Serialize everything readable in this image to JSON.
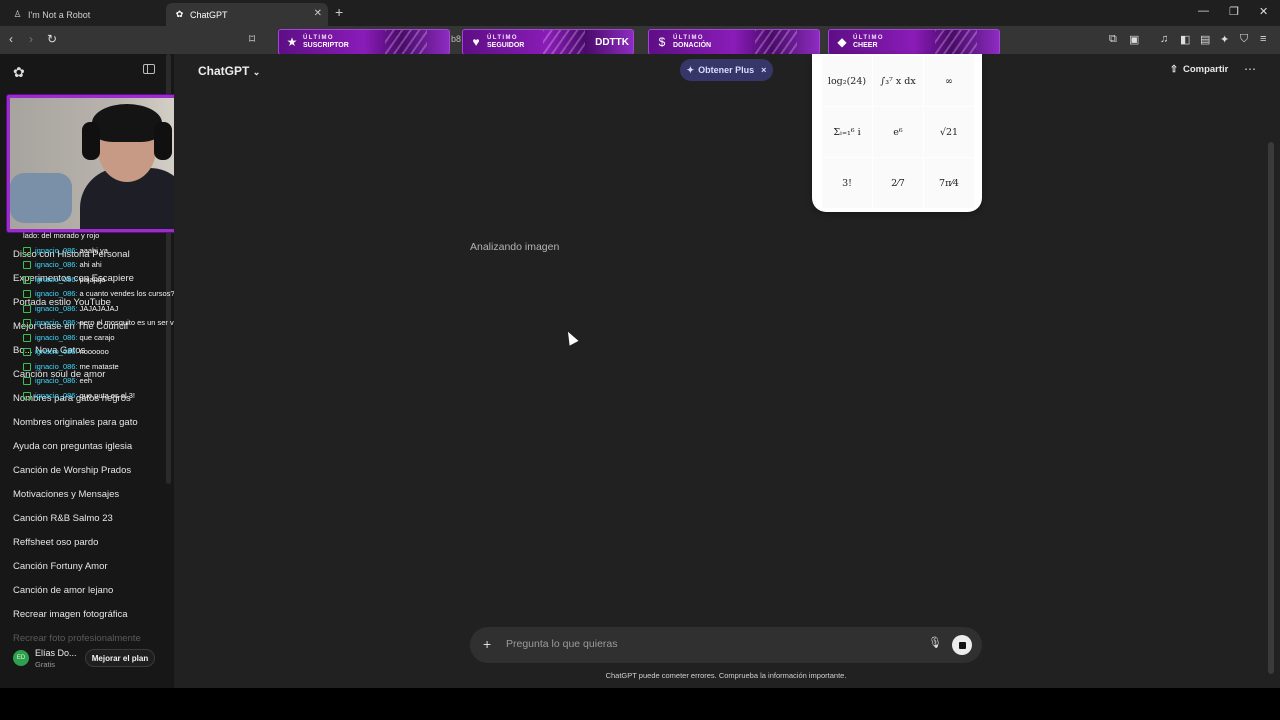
{
  "browser": {
    "tabs": [
      {
        "label": "I'm Not a Robot",
        "icon": "robot-favicon-icon",
        "active": false
      },
      {
        "label": "ChatGPT",
        "icon": "chatgpt-favicon-icon",
        "active": true
      }
    ],
    "url_fragment": "b8"
  },
  "alerts": [
    {
      "line1": "ÚLTIMO",
      "line2": "SUSCRIPTOR",
      "value": "",
      "icon": "star-icon"
    },
    {
      "line1": "ÚLTIMO",
      "line2": "SEGUIDOR",
      "value": "DDTTK",
      "icon": "heart-icon"
    },
    {
      "line1": "ÚLTIMO",
      "line2": "DONACIÓN",
      "value": "",
      "icon": "dollar-icon"
    },
    {
      "line1": "ÚLTIMO",
      "line2": "CHEER",
      "value": "",
      "icon": "diamond-icon"
    }
  ],
  "sidebar": {
    "chats": [
      "Disco con Historia Personal",
      "Experimentos con Escapiere",
      "Portada estilo YouTube",
      "Mejor clase en The Council",
      "Bo... Nova Gatos",
      "Canción soul de amor",
      "Nombres para gatos negros",
      "Nombres originales para gato",
      "Ayuda con preguntas iglesia",
      "Canción de Worship Prados",
      "Motivaciones y Mensajes",
      "Canción R&B Salmo 23",
      "Reffsheet oso pardo",
      "Canción Fortuny Amor",
      "Canción de amor lejano",
      "Recrear imagen fotográfica",
      "Recrear foto profesionalmente"
    ],
    "user": {
      "initials": "ED",
      "name": "Elías Do...",
      "plan": "Gratis",
      "upgrade_label": "Mejorar el plan"
    }
  },
  "stream_chat": [
    {
      "user": "",
      "msg": "lado: del morado y rojo"
    },
    {
      "user": "ignacio_086:",
      "msg": "aaahi ya"
    },
    {
      "user": "ignacio_086:",
      "msg": "ahi ahi"
    },
    {
      "user": "ignacio_086:",
      "msg": "pajajaja"
    },
    {
      "user": "ignacio_086:",
      "msg": "a cuanto vendes los cursos?"
    },
    {
      "user": "ignacio_086:",
      "msg": "JAJAJAJAJ"
    },
    {
      "user": "ignacio_086:",
      "msg": "pero el mosquito es un ser vivo"
    },
    {
      "user": "ignacio_086:",
      "msg": "que carajo"
    },
    {
      "user": "ignacio_086:",
      "msg": "noooooo"
    },
    {
      "user": "ignacio_086:",
      "msg": "me mataste"
    },
    {
      "user": "ignacio_086:",
      "msg": "eeh"
    },
    {
      "user": "ignacio_086:",
      "msg": "que puta es el 3!"
    }
  ],
  "header": {
    "model_label": "ChatGPT",
    "plus_label": "Obtener Plus",
    "share_label": "Compartir"
  },
  "math_grid": [
    "log₂(24)",
    "∫₃⁷ x dx",
    "∞",
    "Σᵢ₌₁⁶ i",
    "e⁶",
    "√21",
    "3!",
    "2⁄7",
    "7π⁄4"
  ],
  "conversation": {
    "status": "Analizando imagen"
  },
  "composer": {
    "placeholder": "Pregunta lo que quieras",
    "disclaimer": "ChatGPT puede cometer errores. Comprueba la información importante."
  }
}
